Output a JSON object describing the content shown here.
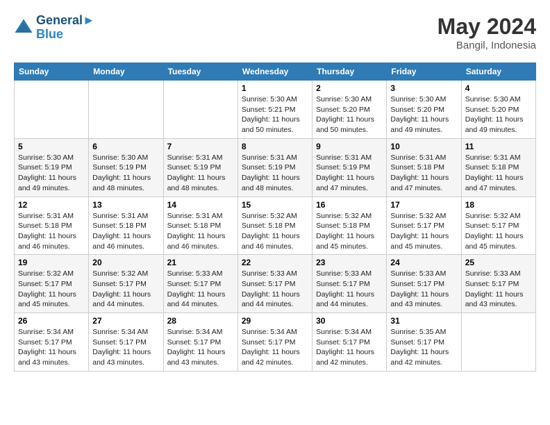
{
  "header": {
    "logo_line1": "General",
    "logo_line2": "Blue",
    "month": "May 2024",
    "location": "Bangil, Indonesia"
  },
  "weekdays": [
    "Sunday",
    "Monday",
    "Tuesday",
    "Wednesday",
    "Thursday",
    "Friday",
    "Saturday"
  ],
  "weeks": [
    [
      {
        "day": "",
        "info": ""
      },
      {
        "day": "",
        "info": ""
      },
      {
        "day": "",
        "info": ""
      },
      {
        "day": "1",
        "info": "Sunrise: 5:30 AM\nSunset: 5:21 PM\nDaylight: 11 hours\nand 50 minutes."
      },
      {
        "day": "2",
        "info": "Sunrise: 5:30 AM\nSunset: 5:20 PM\nDaylight: 11 hours\nand 50 minutes."
      },
      {
        "day": "3",
        "info": "Sunrise: 5:30 AM\nSunset: 5:20 PM\nDaylight: 11 hours\nand 49 minutes."
      },
      {
        "day": "4",
        "info": "Sunrise: 5:30 AM\nSunset: 5:20 PM\nDaylight: 11 hours\nand 49 minutes."
      }
    ],
    [
      {
        "day": "5",
        "info": "Sunrise: 5:30 AM\nSunset: 5:19 PM\nDaylight: 11 hours\nand 49 minutes."
      },
      {
        "day": "6",
        "info": "Sunrise: 5:30 AM\nSunset: 5:19 PM\nDaylight: 11 hours\nand 48 minutes."
      },
      {
        "day": "7",
        "info": "Sunrise: 5:31 AM\nSunset: 5:19 PM\nDaylight: 11 hours\nand 48 minutes."
      },
      {
        "day": "8",
        "info": "Sunrise: 5:31 AM\nSunset: 5:19 PM\nDaylight: 11 hours\nand 48 minutes."
      },
      {
        "day": "9",
        "info": "Sunrise: 5:31 AM\nSunset: 5:19 PM\nDaylight: 11 hours\nand 47 minutes."
      },
      {
        "day": "10",
        "info": "Sunrise: 5:31 AM\nSunset: 5:18 PM\nDaylight: 11 hours\nand 47 minutes."
      },
      {
        "day": "11",
        "info": "Sunrise: 5:31 AM\nSunset: 5:18 PM\nDaylight: 11 hours\nand 47 minutes."
      }
    ],
    [
      {
        "day": "12",
        "info": "Sunrise: 5:31 AM\nSunset: 5:18 PM\nDaylight: 11 hours\nand 46 minutes."
      },
      {
        "day": "13",
        "info": "Sunrise: 5:31 AM\nSunset: 5:18 PM\nDaylight: 11 hours\nand 46 minutes."
      },
      {
        "day": "14",
        "info": "Sunrise: 5:31 AM\nSunset: 5:18 PM\nDaylight: 11 hours\nand 46 minutes."
      },
      {
        "day": "15",
        "info": "Sunrise: 5:32 AM\nSunset: 5:18 PM\nDaylight: 11 hours\nand 46 minutes."
      },
      {
        "day": "16",
        "info": "Sunrise: 5:32 AM\nSunset: 5:18 PM\nDaylight: 11 hours\nand 45 minutes."
      },
      {
        "day": "17",
        "info": "Sunrise: 5:32 AM\nSunset: 5:17 PM\nDaylight: 11 hours\nand 45 minutes."
      },
      {
        "day": "18",
        "info": "Sunrise: 5:32 AM\nSunset: 5:17 PM\nDaylight: 11 hours\nand 45 minutes."
      }
    ],
    [
      {
        "day": "19",
        "info": "Sunrise: 5:32 AM\nSunset: 5:17 PM\nDaylight: 11 hours\nand 45 minutes."
      },
      {
        "day": "20",
        "info": "Sunrise: 5:32 AM\nSunset: 5:17 PM\nDaylight: 11 hours\nand 44 minutes."
      },
      {
        "day": "21",
        "info": "Sunrise: 5:33 AM\nSunset: 5:17 PM\nDaylight: 11 hours\nand 44 minutes."
      },
      {
        "day": "22",
        "info": "Sunrise: 5:33 AM\nSunset: 5:17 PM\nDaylight: 11 hours\nand 44 minutes."
      },
      {
        "day": "23",
        "info": "Sunrise: 5:33 AM\nSunset: 5:17 PM\nDaylight: 11 hours\nand 44 minutes."
      },
      {
        "day": "24",
        "info": "Sunrise: 5:33 AM\nSunset: 5:17 PM\nDaylight: 11 hours\nand 43 minutes."
      },
      {
        "day": "25",
        "info": "Sunrise: 5:33 AM\nSunset: 5:17 PM\nDaylight: 11 hours\nand 43 minutes."
      }
    ],
    [
      {
        "day": "26",
        "info": "Sunrise: 5:34 AM\nSunset: 5:17 PM\nDaylight: 11 hours\nand 43 minutes."
      },
      {
        "day": "27",
        "info": "Sunrise: 5:34 AM\nSunset: 5:17 PM\nDaylight: 11 hours\nand 43 minutes."
      },
      {
        "day": "28",
        "info": "Sunrise: 5:34 AM\nSunset: 5:17 PM\nDaylight: 11 hours\nand 43 minutes."
      },
      {
        "day": "29",
        "info": "Sunrise: 5:34 AM\nSunset: 5:17 PM\nDaylight: 11 hours\nand 42 minutes."
      },
      {
        "day": "30",
        "info": "Sunrise: 5:34 AM\nSunset: 5:17 PM\nDaylight: 11 hours\nand 42 minutes."
      },
      {
        "day": "31",
        "info": "Sunrise: 5:35 AM\nSunset: 5:17 PM\nDaylight: 11 hours\nand 42 minutes."
      },
      {
        "day": "",
        "info": ""
      }
    ]
  ]
}
